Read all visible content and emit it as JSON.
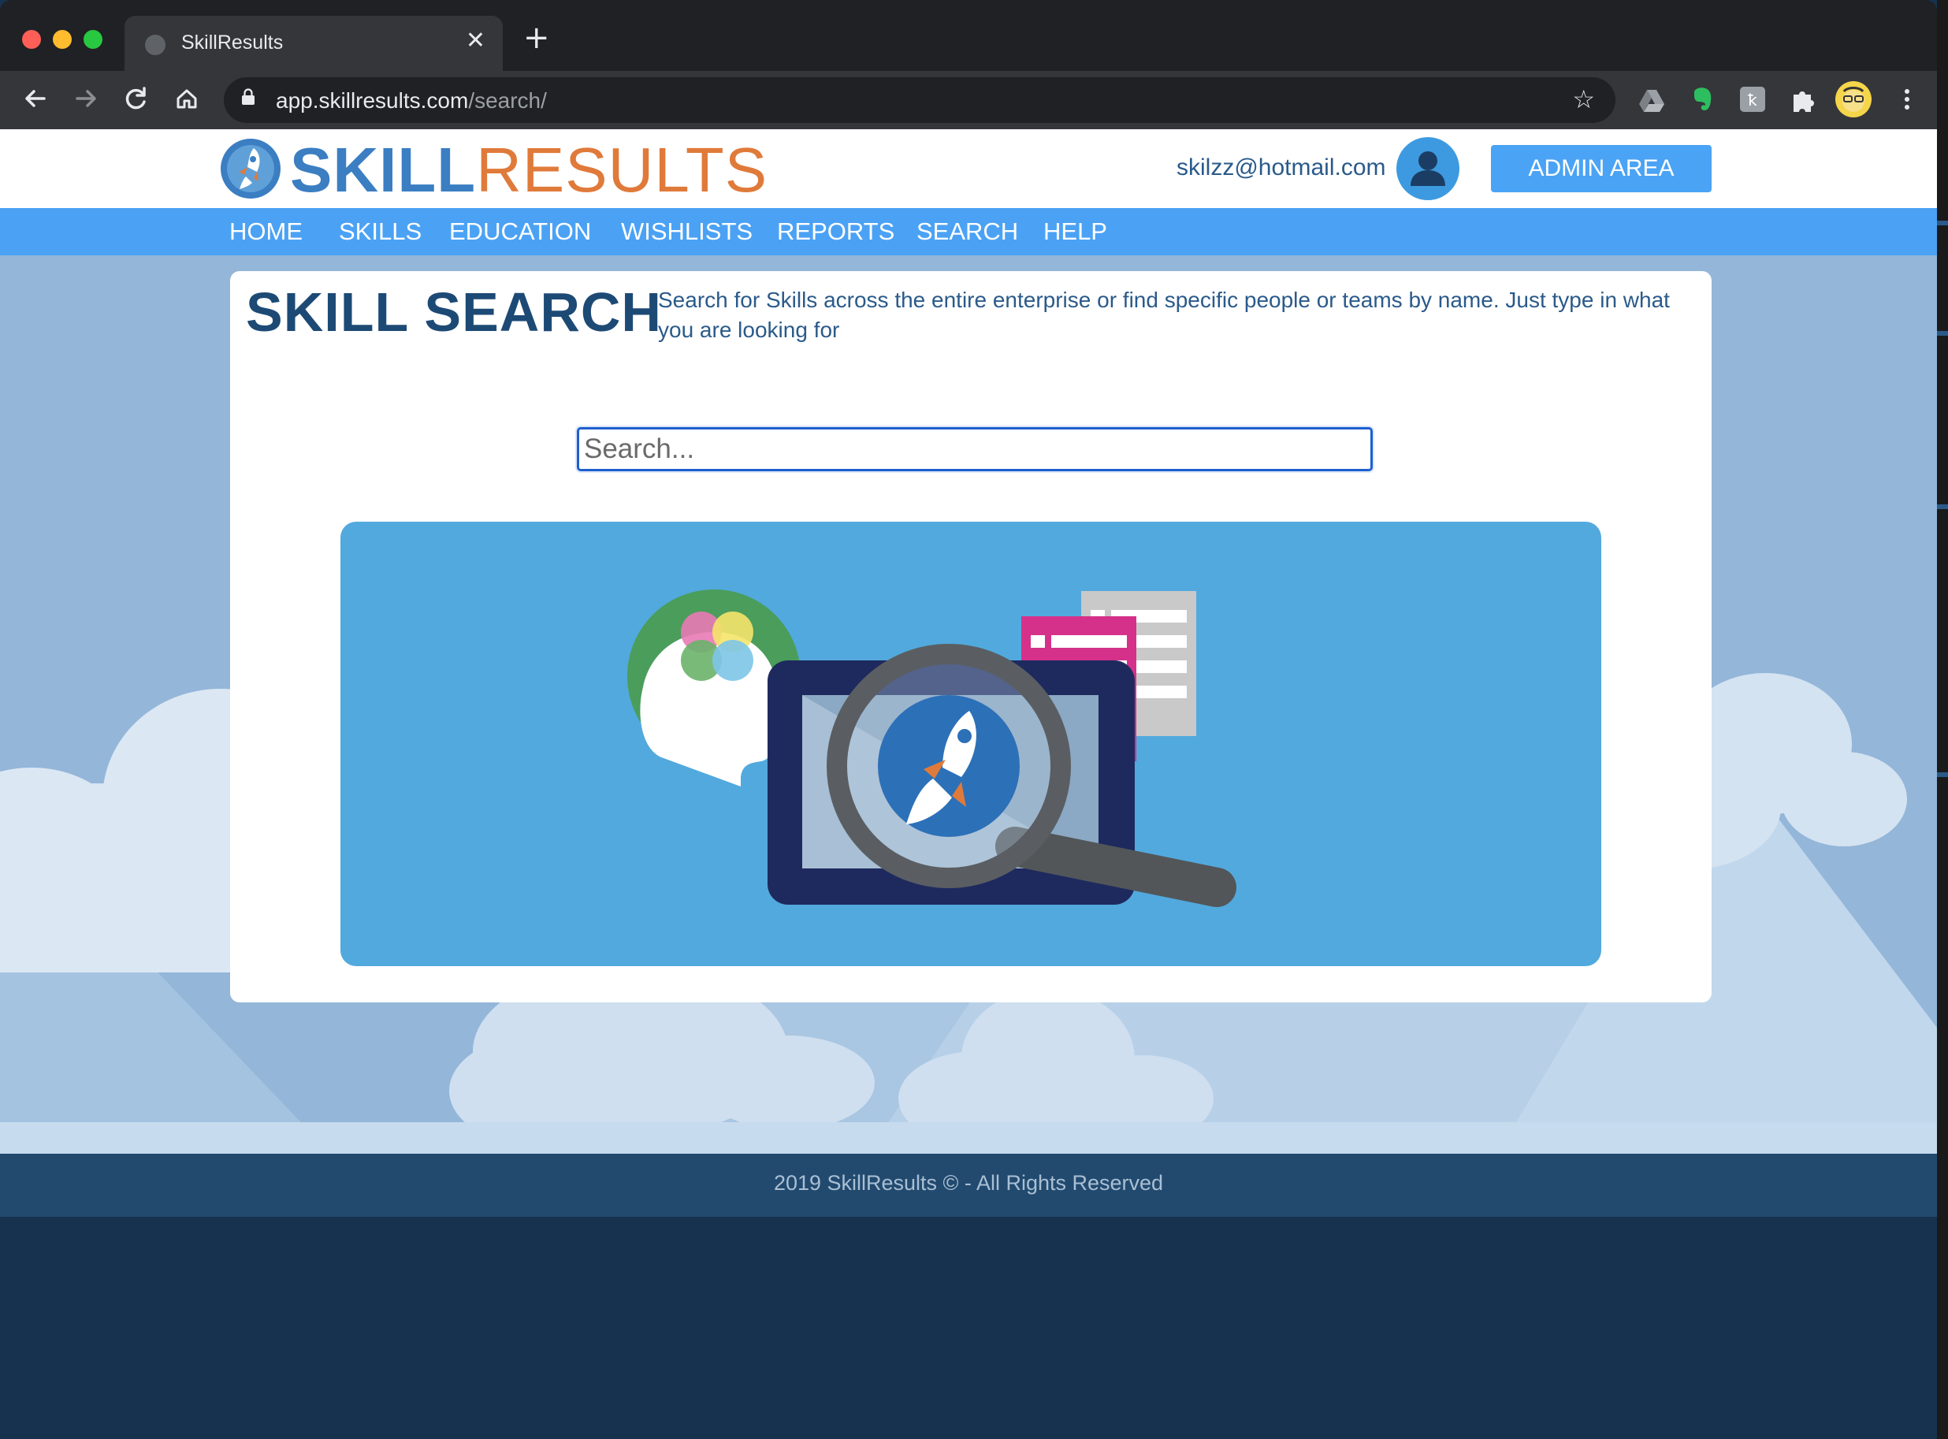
{
  "browser": {
    "tab_title": "SkillResults",
    "new_tab": "+",
    "close_tab": "✕",
    "url_host": "app.skillresults.com",
    "url_path": "/search/"
  },
  "site": {
    "logo_part1": "SKILL",
    "logo_part2": "RESULTS",
    "user_email": "skilzz@hotmail.com",
    "admin_button": "ADMIN AREA",
    "nav": [
      "HOME",
      "SKILLS",
      "EDUCATION",
      "WISHLISTS",
      "REPORTS",
      "SEARCH",
      "HELP"
    ]
  },
  "search_page": {
    "title": "SKILL SEARCH",
    "intro": "Search for Skills across the entire enterprise or find specific people or teams by name. Just type in what you are looking for",
    "search_placeholder": "Search...",
    "search_value": ""
  },
  "footer": {
    "copyright": "2019 SkillResults © - All Rights Reserved"
  },
  "icons": [
    "back-arrow-icon",
    "forward-arrow-icon",
    "reload-icon",
    "home-icon",
    "lock-icon",
    "star-icon",
    "google-drive-icon",
    "evernote-icon",
    "extension-icon",
    "puzzle-icon",
    "profile-icon",
    "more-menu-icon",
    "user-icon",
    "rocket-logo-icon"
  ],
  "colors": {
    "brand_blue": "#3b7ec2",
    "brand_orange": "#e07a3a",
    "nav_blue": "#4ba2f5",
    "heading_navy": "#1d4a75",
    "footer_bg": "#224a6f"
  }
}
